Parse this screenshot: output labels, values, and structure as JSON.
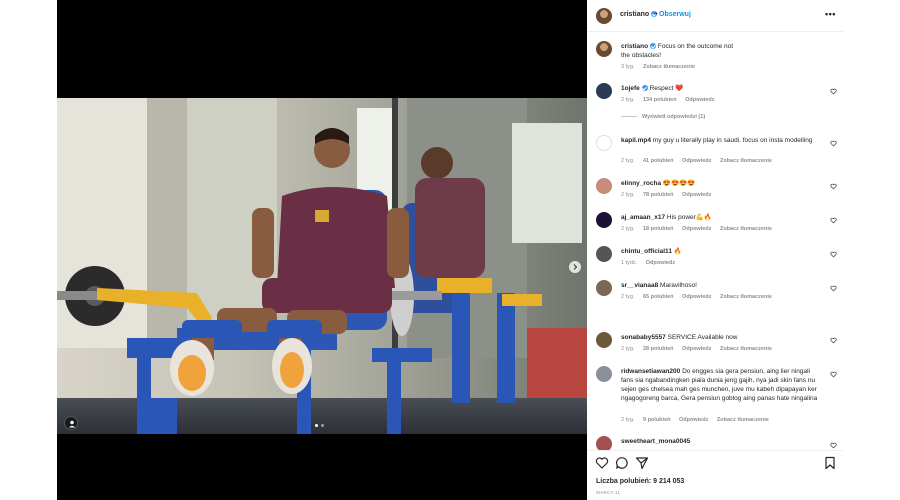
{
  "post": {
    "author": "cristiano",
    "follow_label": "Obserwuj",
    "separator": "•",
    "caption": "Focus on the outcome not the obstacles!",
    "caption_time": "3 tyg.",
    "caption_translate": "Zobacz tłumaczenie",
    "likes_label": "Liczba polubień: 9 214 053",
    "date": "MARCA 11"
  },
  "comments": [
    {
      "user": "1ojefe",
      "text": "Respect ❤️",
      "time": "2 tyg.",
      "likes": "134 polubień",
      "reply": "Odpowiedz",
      "translate": "",
      "view_replies": "Wyświetl odpowiedzi (1)",
      "avatar_color": "#2b3a55"
    },
    {
      "user": "kapil.mp4",
      "text": "my guy u literally play in saudi. focus on insta modelling",
      "time": "2 tyg.",
      "likes": "41 polubień",
      "reply": "Odpowiedz",
      "translate": "Zobacz tłumaczenie",
      "view_replies": "",
      "avatar_color": "#ffffff"
    },
    {
      "user": "elinny_rocha",
      "text": "😍😍😍😍",
      "time": "2 tyg.",
      "likes": "78 polubień",
      "reply": "Odpowiedz",
      "translate": "",
      "view_replies": "",
      "avatar_color": "#c98b7a"
    },
    {
      "user": "aj_amaan_x17",
      "text": "His power💪🔥",
      "time": "2 tyg.",
      "likes": "18 polubień",
      "reply": "Odpowiedz",
      "translate": "Zobacz tłumaczenie",
      "view_replies": "",
      "avatar_color": "#1b1233"
    },
    {
      "user": "chintu_official11",
      "text": "🔥",
      "time": "1 tydz.",
      "likes": "",
      "reply": "Odpowiedz",
      "translate": "",
      "view_replies": "",
      "avatar_color": "#555555"
    },
    {
      "user": "sr__vianaa8",
      "text": "Maravilhoso!",
      "time": "2 tyg.",
      "likes": "65 polubień",
      "reply": "Odpowiedz",
      "translate": "Zobacz tłumaczenie",
      "view_replies": "",
      "avatar_color": "#7a6a55"
    },
    {
      "user": "sonababy5557",
      "text": "SERVICE Available now",
      "time": "2 tyg.",
      "likes": "28 polubień",
      "reply": "Odpowiedz",
      "translate": "Zobacz tłumaczenie",
      "view_replies": "",
      "avatar_color": "#6b5a3a"
    },
    {
      "user": "ridwansetiawan200",
      "text": "Do engges sia gera pensiun, aing lier ningali fans sia ngabandingken piala dunia jeng gajih, nya jadi skin fans nu sejen ges chelsea mah ges munchen, juve mu kabeh dipapayan ker ngagogoreng barca, Gera pensiun goblog aing panas hate ningalina",
      "time": "2 tyg.",
      "likes": "9 polubień",
      "reply": "Odpowiedz",
      "translate": "Zobacz tłumaczenie",
      "view_replies": "",
      "avatar_color": "#8a8f99"
    },
    {
      "user": "sweetheart_mona0045",
      "text": "",
      "time": "",
      "likes": "",
      "reply": "",
      "translate": "",
      "view_replies": "",
      "avatar_color": "#a35050"
    }
  ],
  "icons": [
    "heart-icon",
    "comment-icon",
    "share-icon",
    "bookmark-icon",
    "more-icon",
    "user-tag-icon",
    "chevron-right-icon"
  ],
  "colors": {
    "link": "#0095f6",
    "muted": "#8e8e8e",
    "text": "#262626",
    "verified": "#3897f0"
  }
}
